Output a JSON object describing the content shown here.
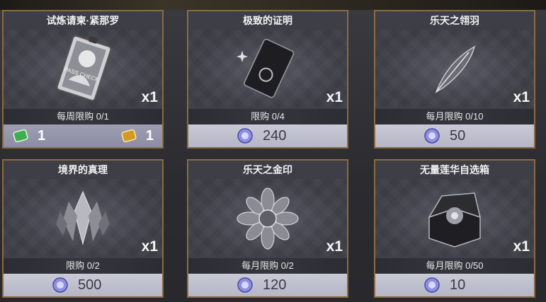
{
  "cards": [
    {
      "title": "试炼请柬·紧那罗",
      "quantity": "x1",
      "limit": "每周限购 0/1",
      "prices": [
        {
          "icon": "green-ticket-icon",
          "amount": "1",
          "color": "#3fae4f"
        },
        {
          "icon": "gold-ticket-icon",
          "amount": "1",
          "color": "#d39a22"
        }
      ],
      "art_icon": "pass-card-icon",
      "art_text": "PASS CHECK"
    },
    {
      "title": "极致的证明",
      "quantity": "x1",
      "limit": "限购 0/4",
      "prices": [
        {
          "icon": "crystal-coin-icon",
          "amount": "240"
        }
      ],
      "art_icon": "dark-card-icon"
    },
    {
      "title": "乐天之翎羽",
      "quantity": "x1",
      "limit": "每月限购 0/10",
      "prices": [
        {
          "icon": "crystal-coin-icon",
          "amount": "50"
        }
      ],
      "art_icon": "feather-icon"
    },
    {
      "title": "境界的真理",
      "quantity": "x1",
      "limit": "限购 0/2",
      "prices": [
        {
          "icon": "crystal-coin-icon",
          "amount": "500"
        }
      ],
      "art_icon": "crystal-cluster-icon"
    },
    {
      "title": "乐天之金印",
      "quantity": "x1",
      "limit": "每月限购 0/2",
      "prices": [
        {
          "icon": "crystal-coin-icon",
          "amount": "120"
        }
      ],
      "art_icon": "lotus-seal-icon"
    },
    {
      "title": "无量莲华自选箱",
      "quantity": "x1",
      "limit": "每月限购 0/50",
      "prices": [
        {
          "icon": "crystal-coin-icon",
          "amount": "10"
        }
      ],
      "art_icon": "chest-icon"
    }
  ],
  "colors": {
    "card_border": "#8a6c3e",
    "coin": "#8f8fe0"
  }
}
